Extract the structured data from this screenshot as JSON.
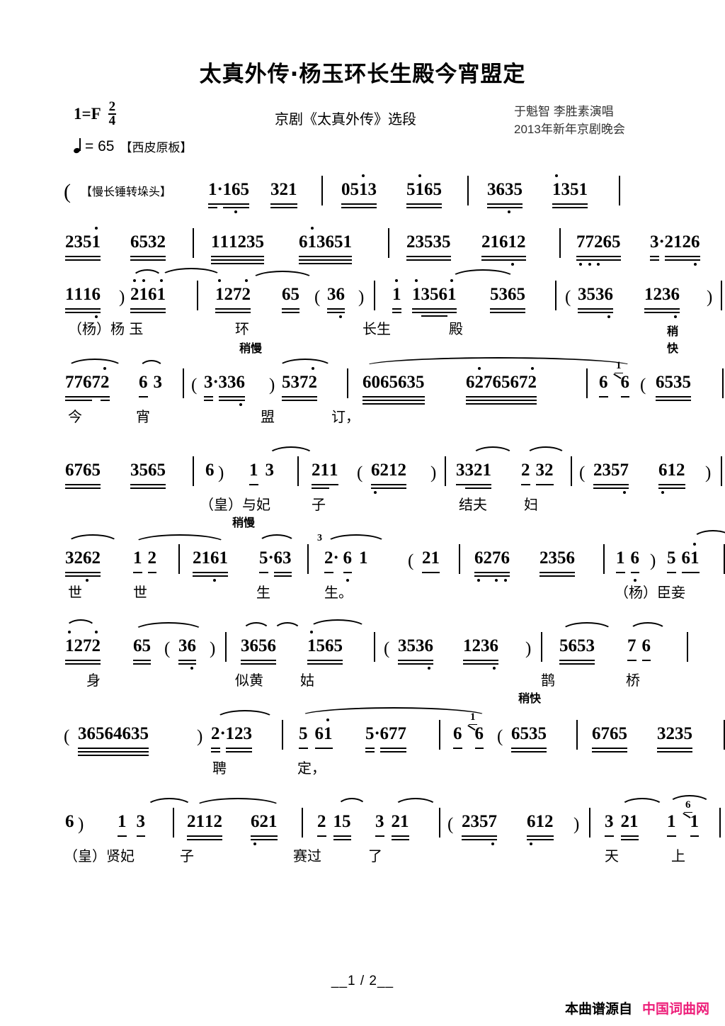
{
  "header": {
    "title": "太真外传·杨玉环长生殿今宵盟定",
    "key_label": "1=",
    "key_value": "F",
    "meter_num": "2",
    "meter_den": "4",
    "tempo_eq": "= 65",
    "style_label": "【西皮原板】",
    "subtitle": "京剧《太真外传》选段",
    "credit_singers": "于魁智 李胜素演唱",
    "credit_event": "2013年新年京剧晚会"
  },
  "intro": {
    "open_paren": "(",
    "percussion": "【慢长锤转垛头】"
  },
  "tempo_marks": {
    "slower": "稍慢",
    "faster": "稍快"
  },
  "notation": {
    "line1": "1·165 321 | 05i3 5i65 | 3635 i351 |",
    "line2": "235i 6532 | 111235 6i3651 | 23535 21612 | 77265 3·2126 |",
    "line3": "1116) 2i6i | i272 65(36) | i i356i 5365 | (3536 1236) |",
    "line4": "77672 6 3 | (3·336)5372 | 6065635 62765672 | 6 i 6 (6535 |",
    "line5": "6765 3565 | 6) 1 3 | 211 (6212) | 3321 2 32 | (2357 612) |",
    "line6": "3262 1 2 | 2161 5·63 | 2· 6 1 (21 | 6276 2356 | 1 6) 5 6i |",
    "line7": "i272 65(36) | 3656 i565 | (3536 1236) | 5653 7 6 |",
    "line8": "(36564635)2·123 | 5 6i 5·677 | 6 i 6 (6535 | 6765 3235 |",
    "line9": "6) 1 3 | 2112 621 | 2 15 3 21 | (2357 612) | 3 21 1 6 1 |"
  },
  "lyrics": {
    "line3": [
      "（杨）杨 玉",
      "环",
      "长生",
      "殿"
    ],
    "line4": [
      "今",
      "宵",
      "盟",
      "订，"
    ],
    "line5": [
      "（皇）与妃",
      "子",
      "结夫",
      "妇"
    ],
    "line6": [
      "世",
      "世",
      "生",
      "生。",
      "（杨）臣妾"
    ],
    "line7": [
      "身",
      "似黄",
      "姑",
      "鹊",
      "桥"
    ],
    "line8": [
      "聘",
      "定，"
    ],
    "line9": [
      "（皇）贤妃",
      "子",
      "赛过",
      "了",
      "天",
      "上"
    ]
  },
  "triplet": "3",
  "grace_notes": {
    "g1": "1",
    "g2": "6"
  },
  "footer": {
    "page_number": "__1 / 2__",
    "watermark_prefix": "本曲谱源自",
    "watermark_site": "中国词曲网"
  },
  "colors": {
    "ink": "#000000",
    "watermark_pink": "#ED1E79",
    "credit_gray": "#333333"
  }
}
